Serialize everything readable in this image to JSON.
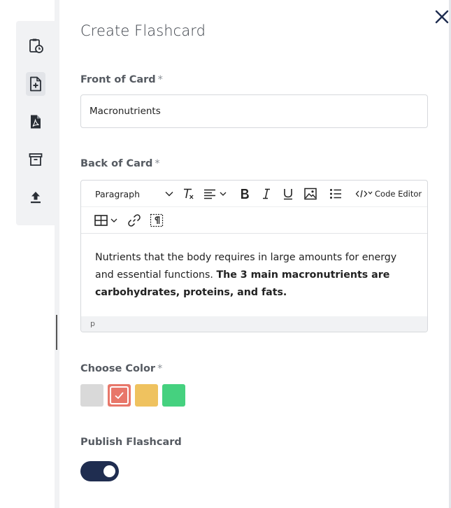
{
  "panel": {
    "title": "Create Flashcard",
    "close_icon": "close-icon"
  },
  "sidebar": {
    "items": [
      {
        "name": "clipboard-clock-icon",
        "active": false
      },
      {
        "name": "add-document-icon",
        "active": true
      },
      {
        "name": "pdf-icon",
        "active": false
      },
      {
        "name": "archive-icon",
        "active": false
      },
      {
        "name": "upload-icon",
        "active": false
      }
    ]
  },
  "front": {
    "label": "Front of Card",
    "required": "*",
    "value": "Macronutrients"
  },
  "back": {
    "label": "Back of Card",
    "required": "*",
    "toolbar": {
      "paragraph_select": "Paragraph",
      "code_editor_label": "Code Editor"
    },
    "content_plain": "Nutrients that the body requires in large amounts for energy and essential functions.",
    "content_bold": "The 3 main macronutrients are carbohydrates, proteins, and fats.",
    "status_path": "p"
  },
  "color": {
    "label": "Choose Color",
    "required": "*",
    "options": [
      {
        "name": "gray",
        "hex": "#d9d9d9",
        "selected": false
      },
      {
        "name": "red",
        "hex": "#e8776a",
        "selected": true
      },
      {
        "name": "yellow",
        "hex": "#efc25f",
        "selected": false
      },
      {
        "name": "green",
        "hex": "#45d17f",
        "selected": false
      }
    ]
  },
  "publish": {
    "label": "Publish Flashcard",
    "enabled": true,
    "track_color": "#1f2d50"
  }
}
